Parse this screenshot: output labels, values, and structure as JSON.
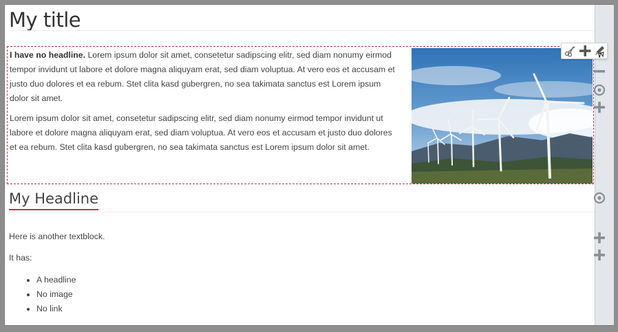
{
  "page": {
    "title": "My title"
  },
  "textblock": {
    "lead_bold": "I have no headline.",
    "lead_rest": " Lorem ipsum dolor sit amet, consetetur sadipscing elitr, sed diam nonumy eirmod tempor invidunt ut labore et dolore magna aliquyam erat, sed diam voluptua. At vero eos et accusam et justo duo dolores et ea rebum. Stet clita kasd gubergren, no sea takimata sanctus est Lorem ipsum dolor sit amet.",
    "paragraph2": "Lorem ipsum dolor sit amet, consetetur sadipscing elitr, sed diam nonumy eirmod tempor invidunt ut labore et dolore magna aliquyam erat, sed diam voluptua. At vero eos et accusam et justo duo dolores et ea rebum. Stet clita kasd gubergren, no sea takimata sanctus est Lorem ipsum dolor sit amet."
  },
  "toolbar": {
    "icons": [
      "scissors-icon",
      "plus-icon",
      "pencil-icon"
    ]
  },
  "section2": {
    "headline": "My Headline",
    "paragraph1": "Here is another textblock.",
    "paragraph2": "It has:",
    "items": [
      "A headline",
      "No image",
      "No link"
    ]
  },
  "rail": {
    "icons": [
      "minus-icon",
      "target-icon",
      "plus-icon",
      "target-icon",
      "plus-icon",
      "plus-icon"
    ]
  },
  "colors": {
    "accent": "#b2354f",
    "rail_bg": "#e3e6ea",
    "outer_bg": "#8e8e8e"
  }
}
